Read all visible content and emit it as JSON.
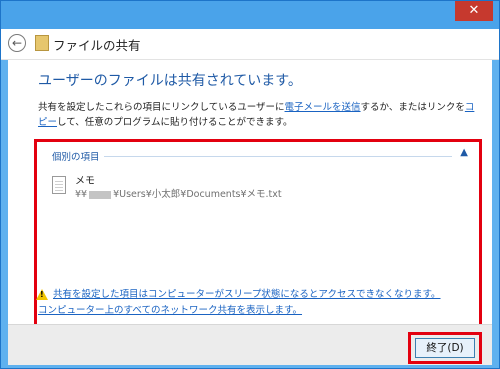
{
  "window": {
    "close_glyph": "✕",
    "nav_title": "ファイルの共有"
  },
  "nav": {
    "back_glyph": "←"
  },
  "main": {
    "heading": "ユーザーのファイルは共有されています。",
    "desc_part1": "共有を設定したこれらの項目にリンクしているユーザーに",
    "desc_link_email": "電子メールを送信",
    "desc_part2": "するか、またはリンクを",
    "desc_link_copy": "コピー",
    "desc_part3": "して、任意のプログラムに貼り付けることができます。"
  },
  "list": {
    "group_label": "個別の項目",
    "collapse_glyph": "▲",
    "item": {
      "name": "メモ",
      "path_prefix": "¥¥",
      "path_suffix": "¥Users¥小太郎¥Documents¥メモ.txt"
    }
  },
  "warning": {
    "text": "共有を設定した項目はコンピューターがスリープ状態になるとアクセスできなくなります。"
  },
  "show_all": {
    "text": "コンピューター上のすべてのネットワーク共有を表示します。"
  },
  "footer": {
    "finish_label": "終了(D)"
  },
  "colors": {
    "accent_red": "#e3000f",
    "link_blue": "#1a63c2",
    "heading_blue": "#1f5aa6",
    "warning_yellow": "#f2c500"
  },
  "icons": {
    "back": "back-arrow-icon",
    "app": "file-share-icon",
    "file": "text-file-icon",
    "warning": "warning-icon",
    "close": "close-icon",
    "collapse": "chevron-up-icon"
  }
}
